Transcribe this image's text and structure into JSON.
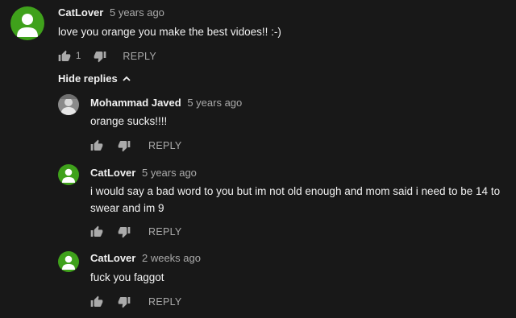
{
  "comments": [
    {
      "author": "CatLover",
      "time": "5 years ago",
      "text": "love you orange you make the best vidoes!! :-)",
      "likes": "1",
      "reply_label": "REPLY",
      "avatar_color": "#3fa11b"
    },
    {
      "author": "Mohammad Javed",
      "time": "5 years ago",
      "text": "orange sucks!!!!",
      "reply_label": "REPLY"
    },
    {
      "author": "CatLover",
      "time": "5 years ago",
      "text": "i would say a bad word to you but im not old enough and mom said i need to be 14 to swear and im 9",
      "reply_label": "REPLY",
      "avatar_color": "#3fa11b"
    },
    {
      "author": "CatLover",
      "time": "2 weeks ago",
      "text": "fuck you faggot",
      "reply_label": "REPLY",
      "avatar_color": "#3fa11b"
    }
  ],
  "hide_replies_label": "Hide replies",
  "colors": {
    "background": "#181818",
    "text": "#f1f1f1",
    "secondary": "#aaaaaa",
    "catlover_avatar": "#3fa11b"
  },
  "icons": [
    "default-avatar-icon",
    "photo-avatar-icon",
    "thumbs-up-icon",
    "thumbs-down-icon",
    "chevron-up-icon"
  ]
}
